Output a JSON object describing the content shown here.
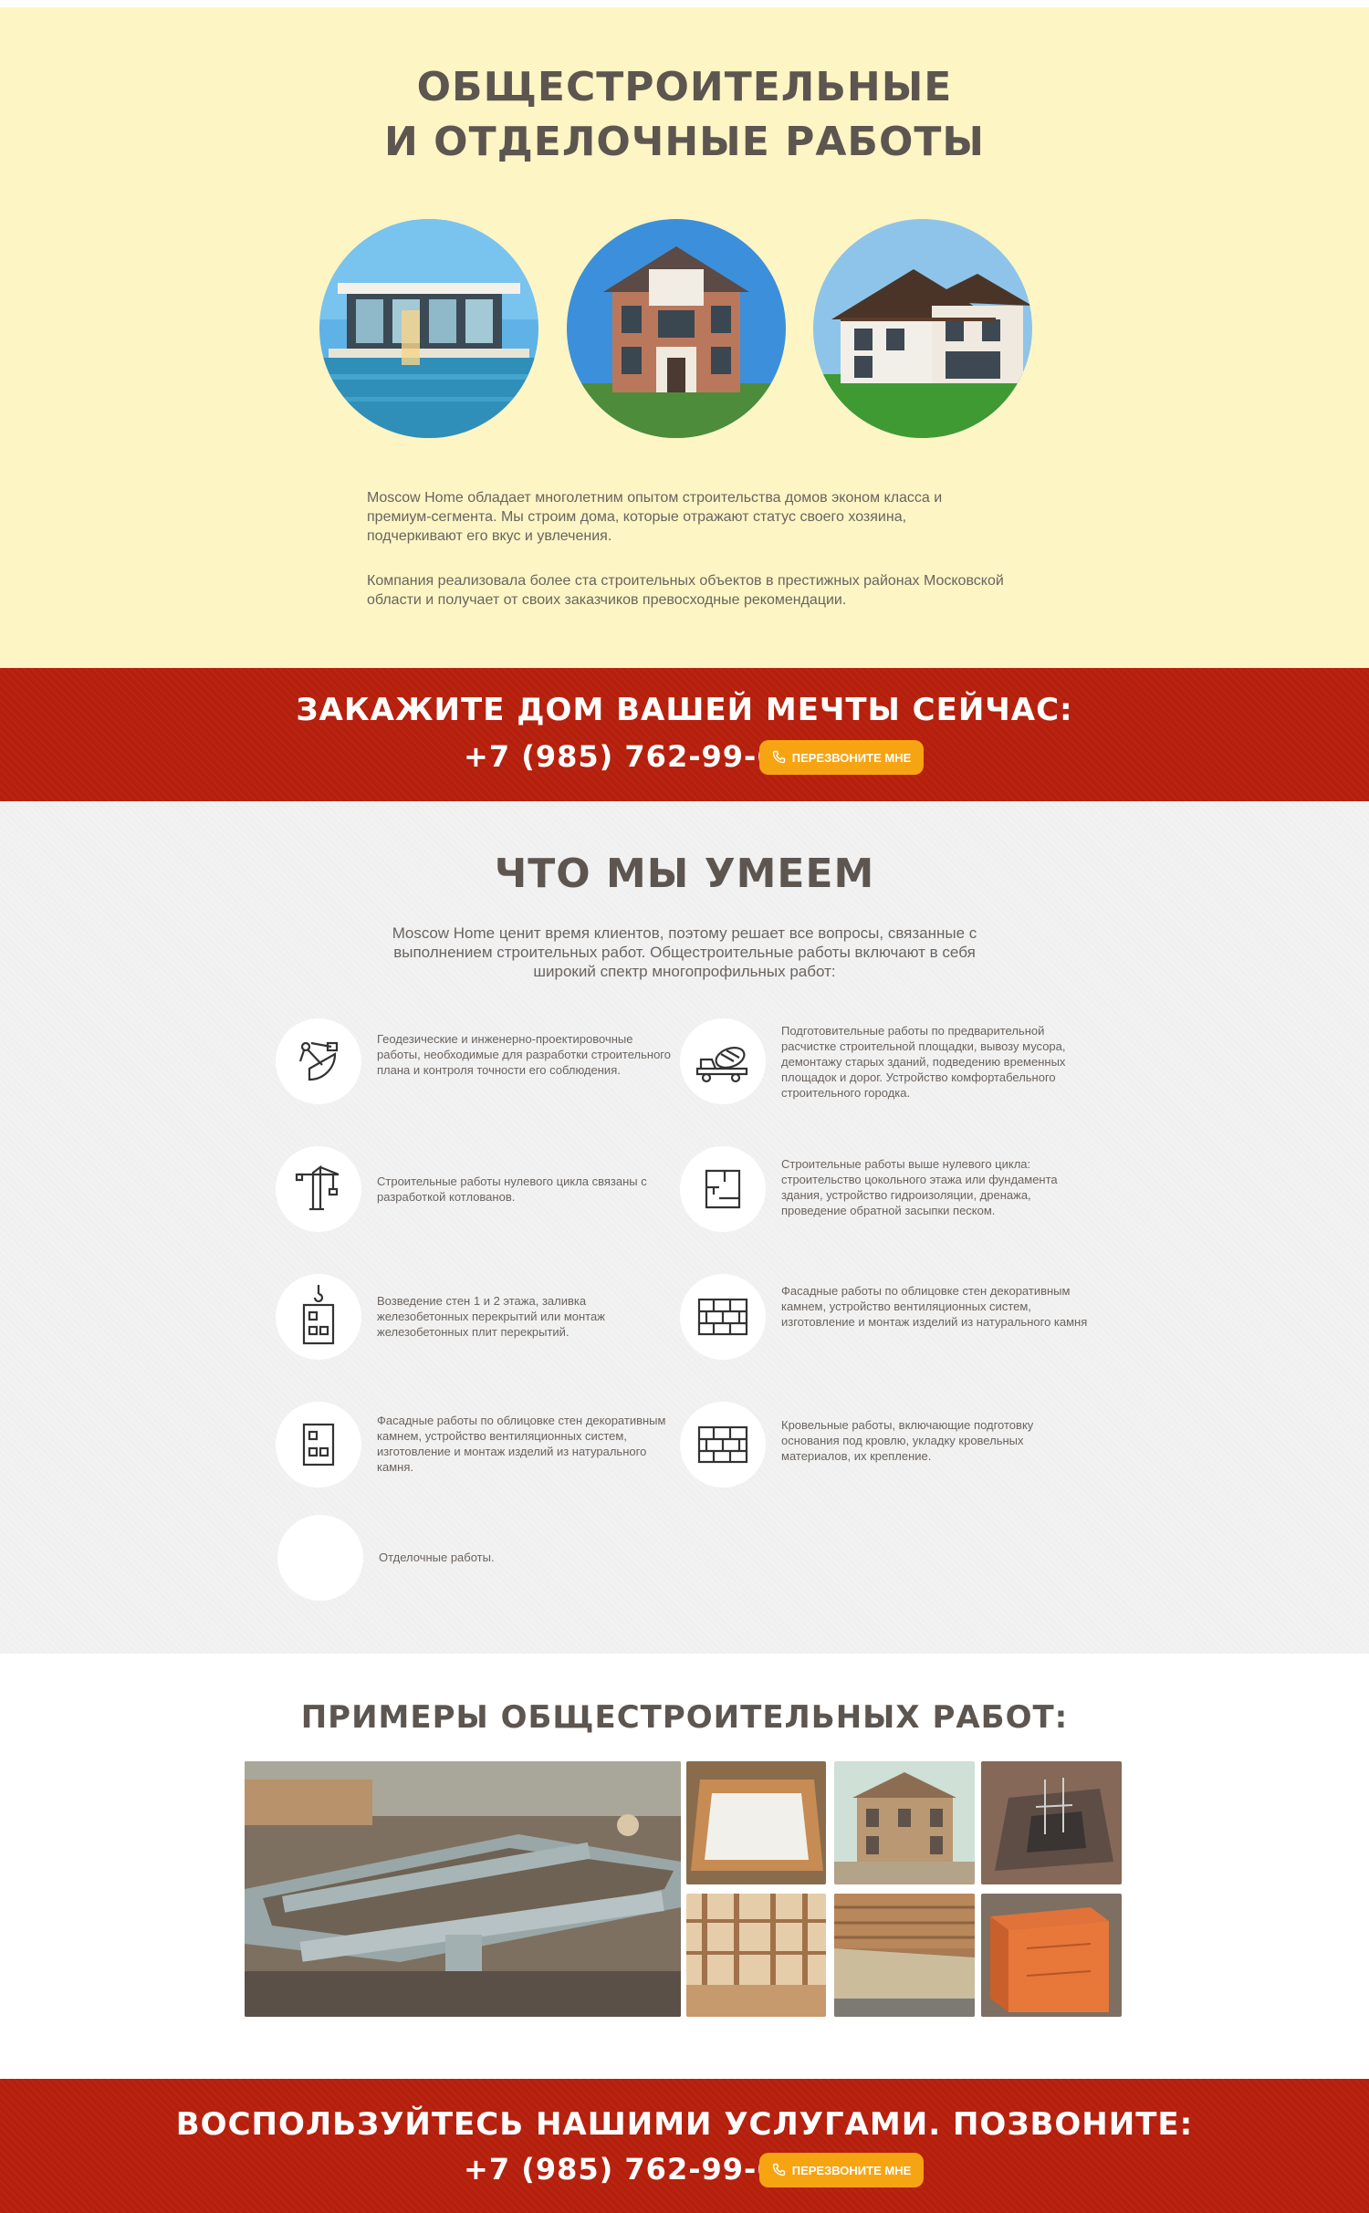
{
  "hero": {
    "title_line1": "ОБЩЕСТРОИТЕЛЬНЫЕ",
    "title_line2": "И ОТДЕЛОЧНЫЕ РАБОТЫ",
    "paragraph1": "Moscow Home обладает многолетним опытом строительства домов эконом класса и премиум-сегмента. Мы строим дома, которые отражают статус своего хозяина, подчеркивают его вкус и увлечения.",
    "paragraph2": "Компания реализовала более ста строительных объектов в престижных районах Московской области и получает от своих заказчиков превосходные рекомендации."
  },
  "cta1": {
    "title": "ЗАКАЖИТЕ ДОМ ВАШЕЙ МЕЧТЫ СЕЙЧАС:",
    "phone": "+7 (985) 762-99-66",
    "button": "ПЕРЕЗВОНИТЕ МНЕ"
  },
  "skills": {
    "title": "ЧТО МЫ УМЕЕМ",
    "intro": "Moscow Home ценит время клиентов, поэтому решает все вопросы, связанные с выполнением строительных работ. Общестроительные работы включают в себя широкий спектр многопрофильных работ:",
    "items": [
      {
        "text": "Геодезические и инженерно-проектировочные работы, необходимые для разработки строительного плана и контроля точности его соблюдения.",
        "icon": "surveying-instrument-icon"
      },
      {
        "text": "Подготовительные работы по предварительной расчистке строительной площадки, вывозу мусора, демонтажу старых зданий, подведению временных площадок и дорог. Устройство комфортабельного строительного городка.",
        "icon": "concrete-mixer-truck-icon"
      },
      {
        "text": "Строительные работы нулевого цикла связаны с разработкой котлованов.",
        "icon": "tower-crane-icon"
      },
      {
        "text": "Строительные работы выше нулевого цикла: строительство цокольного этажа или фундамента здания, устройство гидроизоляции, дренажа, проведение  обратной засыпки песком.",
        "icon": "floor-plan-icon"
      },
      {
        "text": "Возведение стен 1 и 2 этажа, заливка железобетонных перекрытий или монтаж железобетонных плит перекрытий.",
        "icon": "crane-hook-block-icon"
      },
      {
        "text": "Фасадные работы по облицовке стен декоративным камнем, устройство вентиляционных систем, изготовление и монтаж изделий из натурального камня",
        "icon": "brick-wall-icon"
      },
      {
        "text": "Фасадные работы по облицовке стен декоративным камнем, устройство вентиляционных систем, изготовление и монтаж изделий из натурального камня.",
        "icon": "building-block-icon"
      },
      {
        "text": "Кровельные работы, включающие подготовку основания под кровлю, укладку кровельных материалов, их крепление.",
        "icon": "brick-wall-icon"
      },
      {
        "text": "Отделочные работы.",
        "icon": "empty-circle-icon"
      }
    ]
  },
  "examples": {
    "title": "ПРИМЕРЫ ОБЩЕСТРОИТЕЛЬНЫХ РАБОТ:"
  },
  "cta2": {
    "title": "ВОСПОЛЬЗУЙТЕСЬ НАШИМИ УСЛУГАМИ. ПОЗВОНИТЕ:",
    "phone": "+7 (985) 762-99-66",
    "button": "ПЕРЕЗВОНИТЕ МНЕ"
  },
  "colors": {
    "hero_bg": "#fdf5c4",
    "cta_red": "#b51f0c",
    "button_orange": "#f7a412",
    "skills_bg": "#f2f2f2",
    "heading_text": "#5d5550"
  }
}
